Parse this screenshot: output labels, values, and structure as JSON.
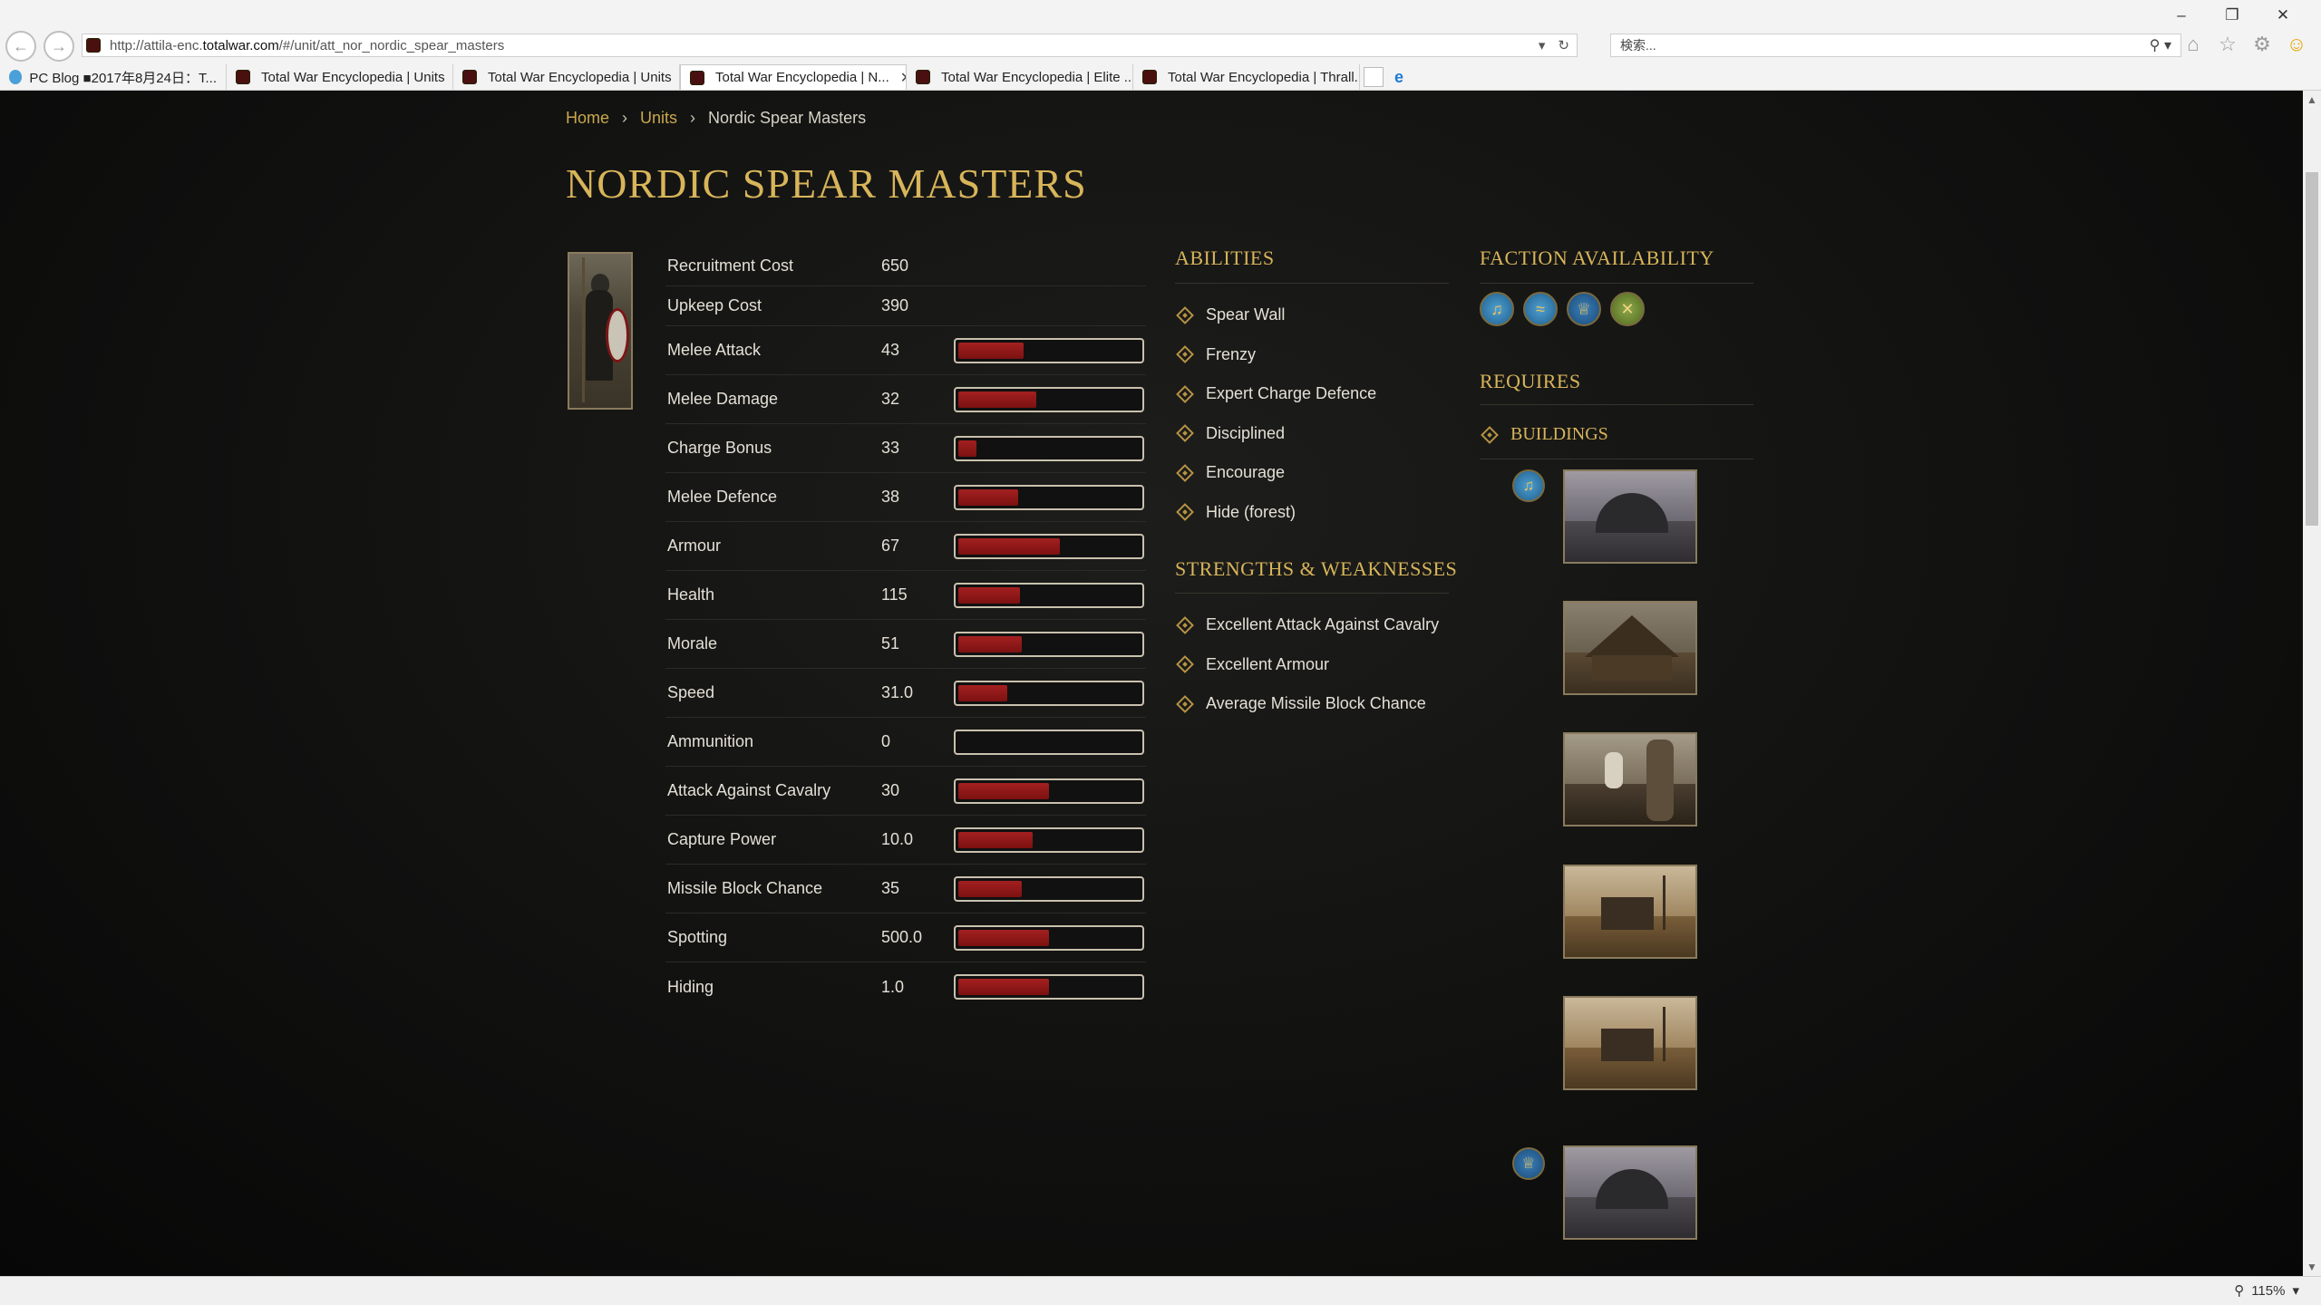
{
  "browser": {
    "url_prefix": "http://attila-enc.",
    "url_domain": "totalwar.com",
    "url_path": "/#/unit/att_nor_nordic_spear_masters",
    "search_placeholder": "検索...",
    "tabs": [
      {
        "label": "PC Blog ■2017年8月24日：T...",
        "active": false
      },
      {
        "label": "Total War Encyclopedia | Units",
        "active": false
      },
      {
        "label": "Total War Encyclopedia | Units",
        "active": false
      },
      {
        "label": "Total War Encyclopedia | N...",
        "active": true
      },
      {
        "label": "Total War Encyclopedia | Elite ...",
        "active": false
      },
      {
        "label": "Total War Encyclopedia | Thrall...",
        "active": false
      }
    ],
    "zoom": "115%"
  },
  "breadcrumb": {
    "home": "Home",
    "units": "Units",
    "current": "Nordic Spear Masters"
  },
  "unit": {
    "title": "NORDIC SPEAR MASTERS",
    "stats": [
      {
        "label": "Recruitment Cost",
        "value": "650"
      },
      {
        "label": "Upkeep Cost",
        "value": "390"
      },
      {
        "label": "Melee Attack",
        "value": "43",
        "bar_fraction": 0.36
      },
      {
        "label": "Melee Damage",
        "value": "32",
        "bar_fraction": 0.43
      },
      {
        "label": "Charge Bonus",
        "value": "33",
        "bar_fraction": 0.1
      },
      {
        "label": "Melee Defence",
        "value": "38",
        "bar_fraction": 0.33
      },
      {
        "label": "Armour",
        "value": "67",
        "bar_fraction": 0.56
      },
      {
        "label": "Health",
        "value": "115",
        "bar_fraction": 0.34
      },
      {
        "label": "Morale",
        "value": "51",
        "bar_fraction": 0.35
      },
      {
        "label": "Speed",
        "value": "31.0",
        "bar_fraction": 0.27
      },
      {
        "label": "Ammunition",
        "value": "0",
        "bar_fraction": 0.0
      },
      {
        "label": "Attack Against Cavalry",
        "value": "30",
        "bar_fraction": 0.5
      },
      {
        "label": "Capture Power",
        "value": "10.0",
        "bar_fraction": 0.41
      },
      {
        "label": "Missile Block Chance",
        "value": "35",
        "bar_fraction": 0.35
      },
      {
        "label": "Spotting",
        "value": "500.0",
        "bar_fraction": 0.5
      },
      {
        "label": "Hiding",
        "value": "1.0",
        "bar_fraction": 0.5
      }
    ]
  },
  "abilities": {
    "heading": "ABILITIES",
    "items": [
      "Spear Wall",
      "Frenzy",
      "Expert Charge Defence",
      "Disciplined",
      "Encourage",
      "Hide (forest)"
    ]
  },
  "strengths": {
    "heading": "STRENGTHS & WEAKNESSES",
    "items": [
      "Excellent Attack Against Cavalry",
      "Excellent Armour",
      "Average Missile Block Chance"
    ]
  },
  "factions": {
    "heading": "FACTION AVAILABILITY",
    "icons": [
      "faction-horn-icon",
      "faction-wave-icon",
      "faction-crown-icon",
      "faction-crossed-axes-icon"
    ]
  },
  "requires": {
    "heading": "REQUIRES",
    "buildings_label": "BUILDINGS"
  },
  "colors": {
    "gold": "#d8b55a",
    "bar_red": "#a32020",
    "page_bg": "#111110"
  }
}
